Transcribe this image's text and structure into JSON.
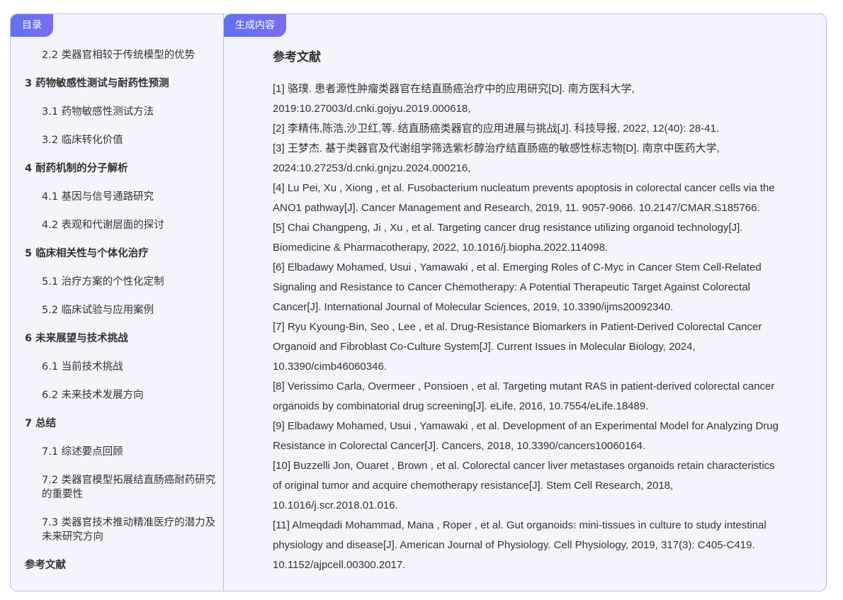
{
  "sidebar": {
    "tab_label": "目录",
    "items": [
      {
        "label": "2.2 类器官相较于传统模型的优势",
        "level": 2
      },
      {
        "label": "3 药物敏感性测试与耐药性预测",
        "level": 1
      },
      {
        "label": "3.1 药物敏感性测试方法",
        "level": 2
      },
      {
        "label": "3.2 临床转化价值",
        "level": 2
      },
      {
        "label": "4 耐药机制的分子解析",
        "level": 1
      },
      {
        "label": "4.1 基因与信号通路研究",
        "level": 2
      },
      {
        "label": "4.2 表观和代谢层面的探讨",
        "level": 2
      },
      {
        "label": "5 临床相关性与个体化治疗",
        "level": 1
      },
      {
        "label": "5.1 治疗方案的个性化定制",
        "level": 2
      },
      {
        "label": "5.2 临床试验与应用案例",
        "level": 2
      },
      {
        "label": "6 未来展望与技术挑战",
        "level": 1
      },
      {
        "label": "6.1 当前技术挑战",
        "level": 2
      },
      {
        "label": "6.2 未来技术发展方向",
        "level": 2
      },
      {
        "label": "7 总结",
        "level": 1
      },
      {
        "label": "7.1 综述要点回顾",
        "level": 2
      },
      {
        "label": "7.2 类器官模型拓展结直肠癌耐药研究的重要性",
        "level": 2
      },
      {
        "label": "7.3 类器官技术推动精准医疗的潜力及未来研究方向",
        "level": 2
      },
      {
        "label": "参考文献",
        "level": 1
      }
    ]
  },
  "main": {
    "tab_label": "生成内容",
    "heading": "参考文献",
    "references": [
      "[1] 骆璞. 患者源性肿瘤类器官在结直肠癌治疗中的应用研究[D]. 南方医科大学, 2019:10.27003/d.cnki.gojyu.2019.000618,",
      "[2] 李精伟,陈浩,沙卫红,等. 结直肠癌类器官的应用进展与挑战[J]. 科技导报, 2022, 12(40): 28-41.",
      "[3] 王梦杰. 基于类器官及代谢组学筛选紫杉醇治疗结直肠癌的敏感性标志物[D]. 南京中医药大学, 2024:10.27253/d.cnki.gnjzu.2024.000216,",
      "[4] Lu Pei, Xu , Xiong , et al. Fusobacterium nucleatum prevents apoptosis in colorectal cancer cells via the ANO1 pathway[J]. Cancer Management and Research, 2019, 11. 9057-9066. 10.2147/CMAR.S185766.",
      "[5] Chai Changpeng, Ji , Xu , et al. Targeting cancer drug resistance utilizing organoid technology[J]. Biomedicine & Pharmacotherapy, 2022, 10.1016/j.biopha.2022.114098.",
      "[6] Elbadawy Mohamed, Usui , Yamawaki , et al. Emerging Roles of C-Myc in Cancer Stem Cell-Related Signaling and Resistance to Cancer Chemotherapy: A Potential Therapeutic Target Against Colorectal Cancer[J]. International Journal of Molecular Sciences, 2019, 10.3390/ijms20092340.",
      "[7] Ryu Kyoung-Bin, Seo , Lee , et al. Drug-Resistance Biomarkers in Patient-Derived Colorectal Cancer Organoid and Fibroblast Co-Culture System[J]. Current Issues in Molecular Biology, 2024, 10.3390/cimb46060346.",
      "[8] Verissimo Carla, Overmeer , Ponsioen , et al. Targeting mutant RAS in patient-derived colorectal cancer organoids by combinatorial drug screening[J]. eLife, 2016, 10.7554/eLife.18489.",
      "[9] Elbadawy Mohamed, Usui , Yamawaki , et al. Development of an Experimental Model for Analyzing Drug Resistance in Colorectal Cancer[J]. Cancers, 2018, 10.3390/cancers10060164.",
      "[10] Buzzelli Jon, Ouaret , Brown , et al. Colorectal cancer liver metastases organoids retain characteristics of original tumor and acquire chemotherapy resistance[J]. Stem Cell Research, 2018, 10.1016/j.scr.2018.01.016.",
      "[11] Almeqdadi Mohammad, Mana , Roper , et al. Gut organoids: mini-tissues in culture to study intestinal physiology and disease[J]. American Journal of Physiology. Cell Physiology, 2019, 317(3): C405-C419. 10.1152/ajpcell.00300.2017."
    ]
  },
  "colors": {
    "accent_start": "#5f72ec",
    "accent_end": "#7c6cf0",
    "panel_bg": "#f3f4fc",
    "border": "#b8c0ef"
  }
}
